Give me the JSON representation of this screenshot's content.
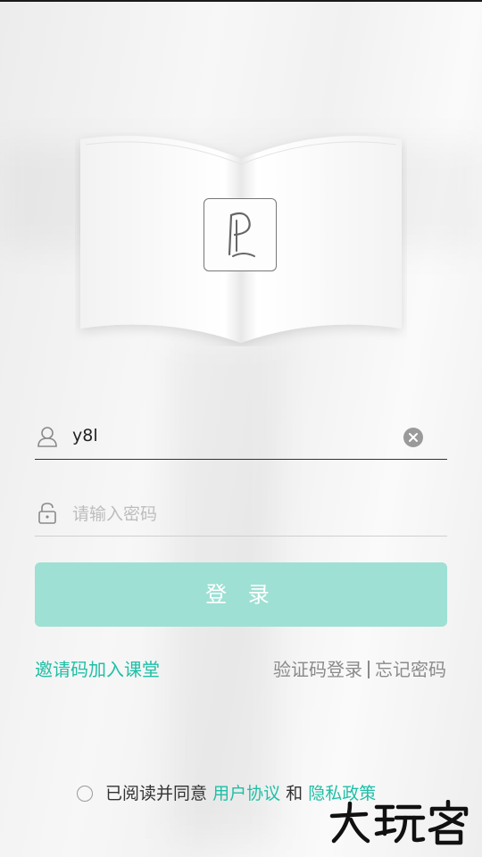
{
  "login": {
    "username_value": "y8l",
    "password_placeholder": "请输入密码",
    "login_button": "登 录"
  },
  "links": {
    "invite": "邀请码加入课堂",
    "sms_login": "验证码登录",
    "forgot_password": "忘记密码"
  },
  "agreement": {
    "prefix": "已阅读并同意",
    "user_agreement": "用户协议",
    "and": "和",
    "privacy_policy": "隐私政策"
  },
  "watermark": {
    "text": "大玩客"
  },
  "colors": {
    "accent": "#1fbfa6",
    "button": "#9ee0d4"
  }
}
